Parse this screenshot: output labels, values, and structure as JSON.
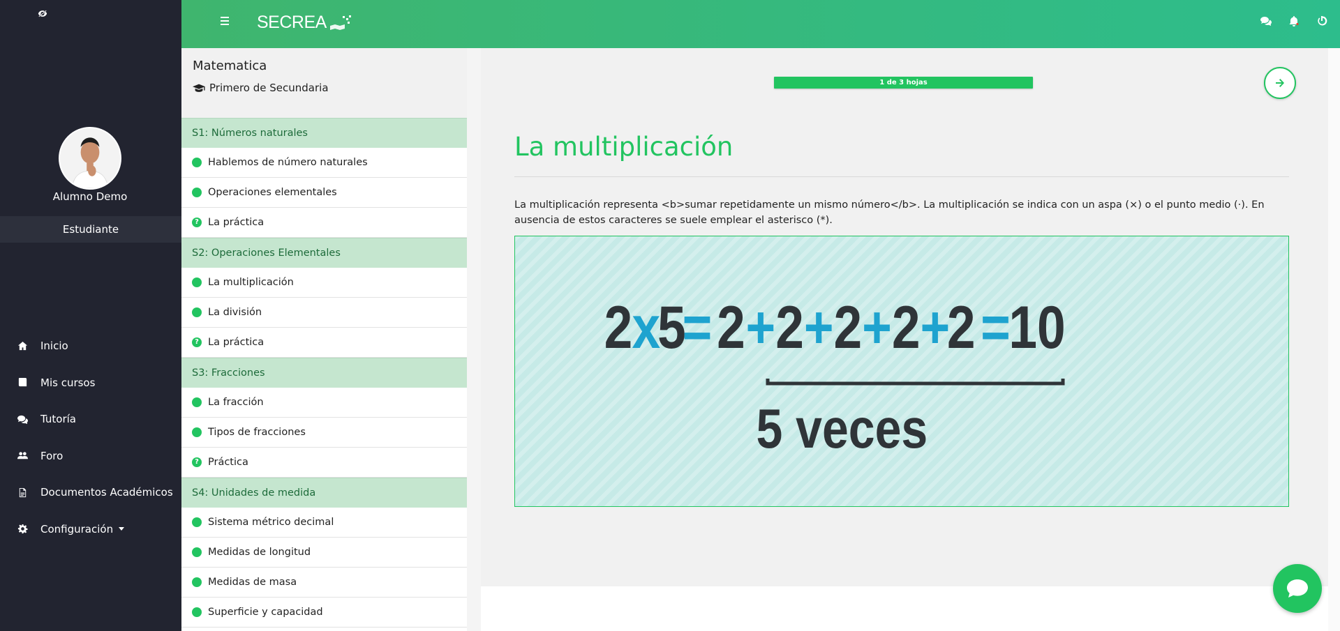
{
  "topbar": {
    "brand": "SECREA",
    "icons": [
      "chat-icon",
      "bell-icon",
      "power-icon"
    ]
  },
  "sidebar": {
    "user_name": "Alumno Demo",
    "role": "Estudiante",
    "items": [
      {
        "label": "Inicio",
        "icon": "home-icon"
      },
      {
        "label": "Mis cursos",
        "icon": "book-icon"
      },
      {
        "label": "Tutoría",
        "icon": "comments-icon"
      },
      {
        "label": "Foro",
        "icon": "users-icon"
      },
      {
        "label": "Documentos Académicos",
        "icon": "document-icon"
      },
      {
        "label": "Configuración",
        "icon": "gear-icon"
      }
    ]
  },
  "course": {
    "title": "Matematica",
    "grade": "Primero de Secundaria",
    "sections": [
      {
        "title": "S1: Números naturales",
        "lessons": [
          {
            "label": "Hablemos de número naturales",
            "type": "dot"
          },
          {
            "label": "Operaciones elementales",
            "type": "dot"
          },
          {
            "label": "La práctica",
            "type": "question"
          }
        ]
      },
      {
        "title": "S2: Operaciones Elementales",
        "lessons": [
          {
            "label": "La multiplicación",
            "type": "dot"
          },
          {
            "label": "La división",
            "type": "dot"
          },
          {
            "label": "La práctica",
            "type": "question"
          }
        ]
      },
      {
        "title": "S3: Fracciones",
        "lessons": [
          {
            "label": "La fracción",
            "type": "dot"
          },
          {
            "label": "Tipos de fracciones",
            "type": "dot"
          },
          {
            "label": "Práctica",
            "type": "question"
          }
        ]
      },
      {
        "title": "S4: Unidades de medida",
        "lessons": [
          {
            "label": "Sistema métrico decimal",
            "type": "dot"
          },
          {
            "label": "Medidas de longitud",
            "type": "dot"
          },
          {
            "label": "Medidas de masa",
            "type": "dot"
          },
          {
            "label": "Superficie y capacidad",
            "type": "dot"
          }
        ]
      }
    ]
  },
  "main": {
    "progress_label": "1 de 3 hojas",
    "lesson_title": "La multiplicación",
    "lesson_text": "La multiplicación representa <b>sumar repetidamente un mismo número</b>. La multiplicación se indica con un aspa (×) o el punto medio (·). En ausencia de estos caracteres se suele emplear el asterisco (*).",
    "illustration": {
      "tokens": [
        "2",
        "x",
        "5",
        "=",
        "2",
        "+",
        "2",
        "+",
        "2",
        "+",
        "2",
        "+",
        "2",
        "=",
        "10"
      ],
      "caption": "5 veces"
    }
  },
  "colors": {
    "accent": "#22c460",
    "sidebar_bg": "#222430",
    "section_bg": "#c5e6cf",
    "illus_bg": "#c6eae7",
    "number_dark": "#2f3438",
    "operator_blue": "#1ea3cf"
  }
}
